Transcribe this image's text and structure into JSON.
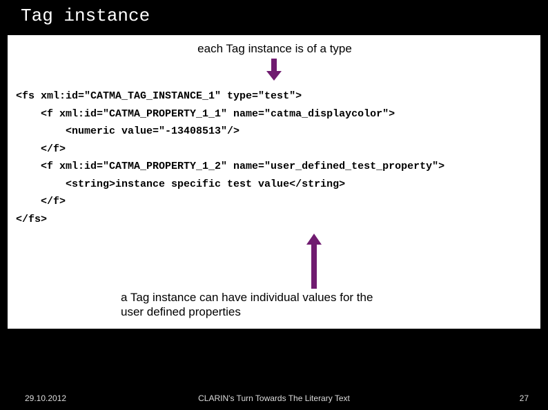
{
  "title": "Tag instance",
  "caption_top": "each Tag instance is of a type",
  "code": {
    "l1": "<fs xml:id=\"CATMA_TAG_INSTANCE_1\" type=\"test\">",
    "l2": "    <f xml:id=\"CATMA_PROPERTY_1_1\" name=\"catma_displaycolor\">",
    "l3": "        <numeric value=\"-13408513\"/>",
    "l4": "    </f>",
    "l5": "    <f xml:id=\"CATMA_PROPERTY_1_2\" name=\"user_defined_test_property\">",
    "l6": "        <string>instance specific test value</string>",
    "l7": "    </f>",
    "l8": "</fs>"
  },
  "caption_bottom": "a Tag instance can have individual values for the user defined properties",
  "footer": {
    "date": "29.10.2012",
    "center": "CLARIN's Turn Towards The Literary Text",
    "page": "27"
  },
  "colors": {
    "arrow": "#701c70"
  }
}
